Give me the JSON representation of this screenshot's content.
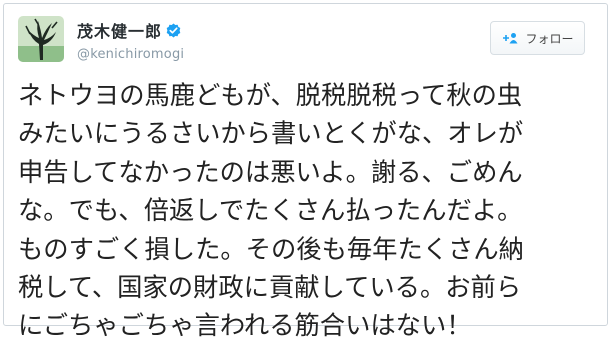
{
  "author": {
    "name": "茂木健一郎",
    "handle": "@kenichiromogi",
    "verified": true
  },
  "follow_button": {
    "label": "フォロー",
    "icon": "add-person-icon"
  },
  "tweet": {
    "lines": [
      "ネトウヨの馬鹿どもが、脱税脱税って秋の虫",
      "みたいにうるさいから書いとくがな、オレが",
      "申告してなかったのは悪いよ。謝る、ごめん",
      "な。でも、倍返しでたくさん払ったんだよ。",
      "ものすごく損した。その後も毎年たくさん納",
      "税して、国家の財政に貢献している。お前ら",
      "にごちゃごちゃ言われる筋合いはない！"
    ]
  },
  "colors": {
    "verified_badge": "#1da1f2",
    "handle": "#8899a6",
    "text": "#222222"
  }
}
